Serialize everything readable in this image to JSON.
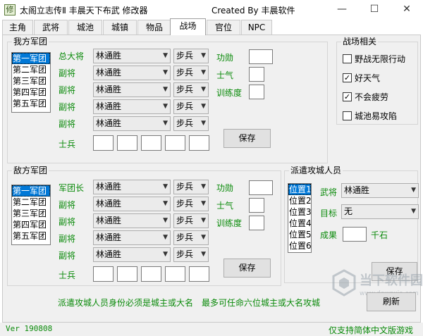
{
  "window": {
    "title": "太阁立志传Ⅱ 丰晨天下布武 修改器",
    "center_title": "Created By 丰晨软件",
    "icon_char": "修",
    "minimize": "—",
    "maximize": "☐",
    "close": "✕"
  },
  "tabs": [
    "主角",
    "武将",
    "城池",
    "城镇",
    "物品",
    "战场",
    "官位",
    "NPC"
  ],
  "active_tab": "战场",
  "own_army": {
    "title": "我方军团",
    "legions": [
      "第一军团",
      "第二军团",
      "第三军团",
      "第四军团",
      "第五军团"
    ],
    "selected": 0,
    "rows": [
      {
        "label": "总大将",
        "general": "林通胜",
        "type": "步兵"
      },
      {
        "label": "副将",
        "general": "林通胜",
        "type": "步兵"
      },
      {
        "label": "副将",
        "general": "林通胜",
        "type": "步兵"
      },
      {
        "label": "副将",
        "general": "林通胜",
        "type": "步兵"
      },
      {
        "label": "副将",
        "general": "林通胜",
        "type": "步兵"
      }
    ],
    "soldiers_label": "士兵",
    "merit_label": "功勋",
    "morale_label": "士气",
    "training_label": "训练度",
    "save_label": "保存"
  },
  "enemy_army": {
    "title": "敌方军团",
    "legions": [
      "第一军团",
      "第二军团",
      "第三军团",
      "第四军团",
      "第五军团"
    ],
    "selected": 0,
    "rows": [
      {
        "label": "军团长",
        "general": "林通胜",
        "type": "步兵"
      },
      {
        "label": "副将",
        "general": "林通胜",
        "type": "步兵"
      },
      {
        "label": "副将",
        "general": "林通胜",
        "type": "步兵"
      },
      {
        "label": "副将",
        "general": "林通胜",
        "type": "步兵"
      },
      {
        "label": "副将",
        "general": "林通胜",
        "type": "步兵"
      }
    ],
    "soldiers_label": "士兵",
    "merit_label": "功勋",
    "morale_label": "士气",
    "training_label": "训练度",
    "save_label": "保存"
  },
  "battle_options": {
    "title": "战场相关",
    "items": [
      {
        "label": "野战无限行动",
        "checked": false
      },
      {
        "label": "好天气",
        "checked": true
      },
      {
        "label": "不会疲劳",
        "checked": true
      },
      {
        "label": "城池易攻陷",
        "checked": false
      }
    ]
  },
  "siege": {
    "title": "派遣攻城人员",
    "positions": [
      "位置1",
      "位置2",
      "位置3",
      "位置4",
      "位置5",
      "位置6"
    ],
    "selected": 0,
    "general_label": "武将",
    "general_value": "林通胜",
    "target_label": "目标",
    "target_value": "无",
    "result_label": "成果",
    "result_unit": "千石",
    "save_label": "保存"
  },
  "notes": {
    "note1": "派遣攻城人员身份必须是城主或大名",
    "note2": "最多可任命六位城主或大名攻城"
  },
  "refresh_label": "刷新",
  "status": {
    "version": "Ver 190808",
    "support": "仅支持简体中文版游戏"
  },
  "watermark": {
    "brand": "当下软件园",
    "url": "www.downxia.com"
  },
  "colors": {
    "label_green": "#0a8a0a",
    "selection_blue": "#0078d7"
  }
}
